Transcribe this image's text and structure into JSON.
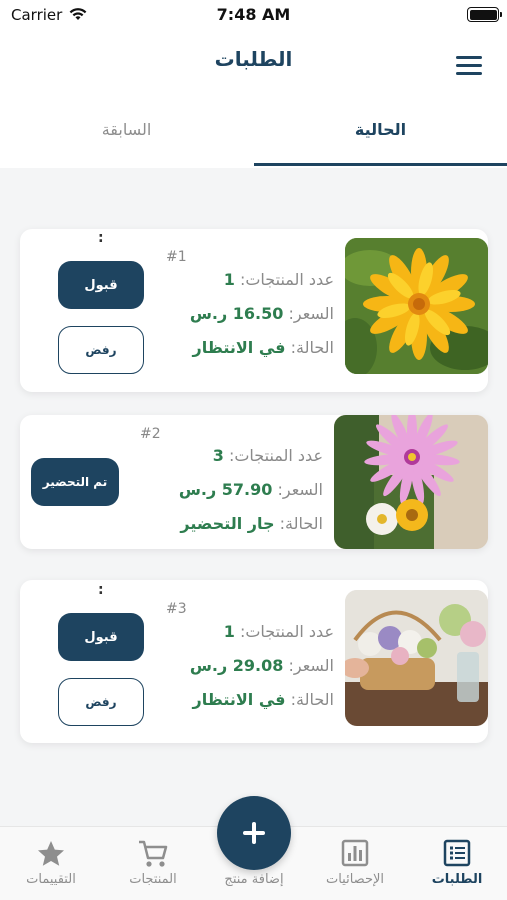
{
  "status_bar": {
    "carrier": "Carrier",
    "time": "7:48 AM"
  },
  "header": {
    "title": "الطلبات",
    "menu_icon": "hamburger-menu-icon"
  },
  "tabs": [
    {
      "label": "الحالية",
      "active": true
    },
    {
      "label": "السابقة",
      "active": false
    }
  ],
  "orders": [
    {
      "number": "#1",
      "count_label": "عدد المنتجات:",
      "count": "1",
      "price_label": "السعر:",
      "price": "16.50 ر.س",
      "status_label": "الحالة:",
      "status": "في الانتظار",
      "colon": ":",
      "accept_label": "قبول",
      "reject_label": "رفض",
      "image": "yellow-flower"
    },
    {
      "number": "#2",
      "count_label": "عدد المنتجات:",
      "count": "3",
      "price_label": "السعر:",
      "price": "57.90 ر.س",
      "status_label": "الحالة:",
      "status": "جار التحضير",
      "done_label": "تم التحضير",
      "image": "pink-flower"
    },
    {
      "number": "#3",
      "count_label": "عدد المنتجات:",
      "count": "1",
      "price_label": "السعر:",
      "price": "29.08 ر.س",
      "status_label": "الحالة:",
      "status": "في الانتظار",
      "colon": ":",
      "accept_label": "قبول",
      "reject_label": "رفض",
      "image": "flower-basket"
    }
  ],
  "tabbar": {
    "items": [
      {
        "label": "الطلبات",
        "icon": "orders-list-icon",
        "active": true
      },
      {
        "label": "الإحصائيات",
        "icon": "statistics-chart-icon",
        "active": false
      },
      {
        "label": "إضافة منتج",
        "icon": "plus-icon",
        "active": false
      },
      {
        "label": "المنتجات",
        "icon": "shopping-cart-icon",
        "active": false
      },
      {
        "label": "التقييمات",
        "icon": "star-icon",
        "active": false
      }
    ]
  },
  "colors": {
    "primary": "#1e4460",
    "success_text": "#2e7d4f",
    "muted": "#8e8e8e",
    "background": "#f4f5f6"
  }
}
